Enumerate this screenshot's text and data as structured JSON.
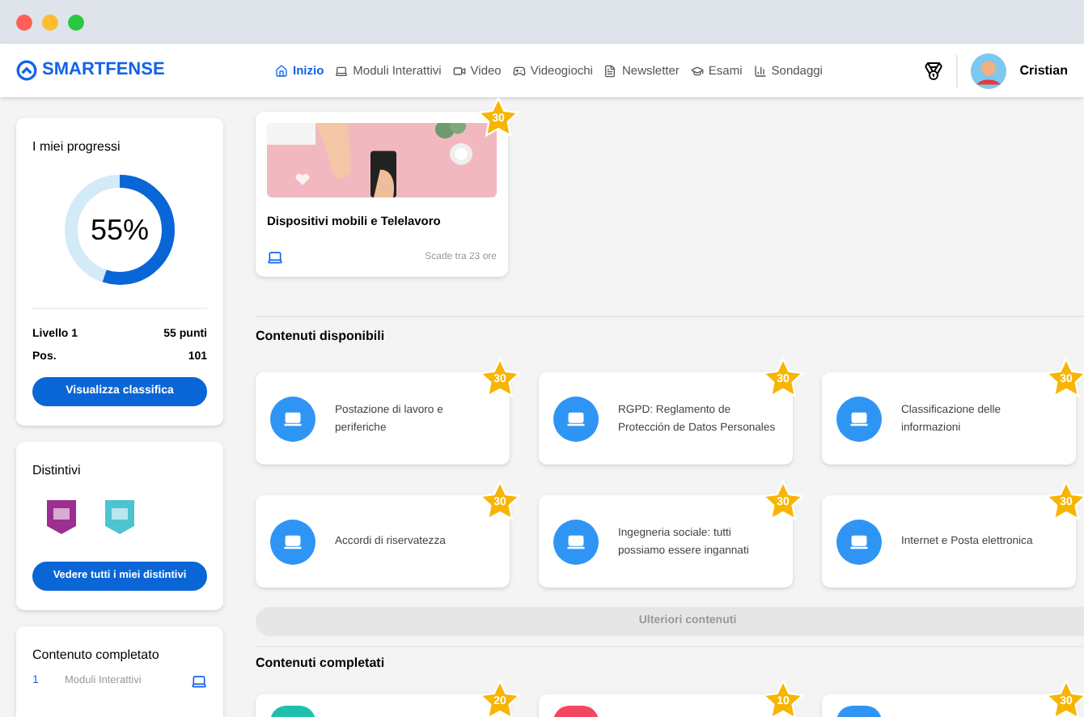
{
  "brand": "SMARTFENSE",
  "nav": [
    {
      "label": "Inizio",
      "selected": true
    },
    {
      "label": "Moduli Interattivi",
      "selected": false
    },
    {
      "label": "Video",
      "selected": false
    },
    {
      "label": "Videogiochi",
      "selected": false
    },
    {
      "label": "Newsletter",
      "selected": false
    },
    {
      "label": "Esami",
      "selected": false
    },
    {
      "label": "Sondaggi",
      "selected": false
    }
  ],
  "user": {
    "name": "Cristian"
  },
  "progress": {
    "title": "I miei progressi",
    "percent": "55%",
    "level": 0.55,
    "rows": [
      {
        "label": "Livello 1",
        "value": "55 punti"
      },
      {
        "label": "Pos.",
        "value": "101"
      }
    ],
    "button": "Visualizza classifica"
  },
  "badges": {
    "title": "Distintivi",
    "items": [
      {
        "color": "#9c2f8f"
      },
      {
        "color": "#4fc3cf"
      }
    ],
    "button": "Vedere tutti i miei distintivi"
  },
  "completed": {
    "title": "Contenuto completato",
    "rows": [
      {
        "count": "1",
        "label": "Moduli Interattivi"
      }
    ]
  },
  "featured": {
    "title": "Dispositivi mobili e Telelavoro",
    "due": "Scade tra 23 ore",
    "points": "30"
  },
  "available": {
    "title": "Contenuti disponibili",
    "items": [
      {
        "title": "Postazione di lavoro e periferiche",
        "points": "30",
        "color": "#2f95f5"
      },
      {
        "title": "RGPD: Reglamento de Protección de Datos Personales",
        "points": "30",
        "color": "#2f95f5"
      },
      {
        "title": "Classificazione delle informazioni",
        "points": "30",
        "color": "#2f95f5"
      },
      {
        "title": "Accordi di riservatezza",
        "points": "30",
        "color": "#2f95f5"
      },
      {
        "title": "Ingegneria sociale: tutti possiamo essere ingannati",
        "points": "30",
        "color": "#2f95f5"
      },
      {
        "title": "Internet e Posta elettronica",
        "points": "30",
        "color": "#2f95f5"
      }
    ],
    "more": "Ulteriori contenuti"
  },
  "done": {
    "title": "Contenuti completati",
    "items": [
      {
        "points": "20",
        "color": "#1fbfae"
      },
      {
        "points": "10",
        "color": "#f2475f"
      },
      {
        "points": "30",
        "color": "#2f95f5"
      }
    ]
  }
}
